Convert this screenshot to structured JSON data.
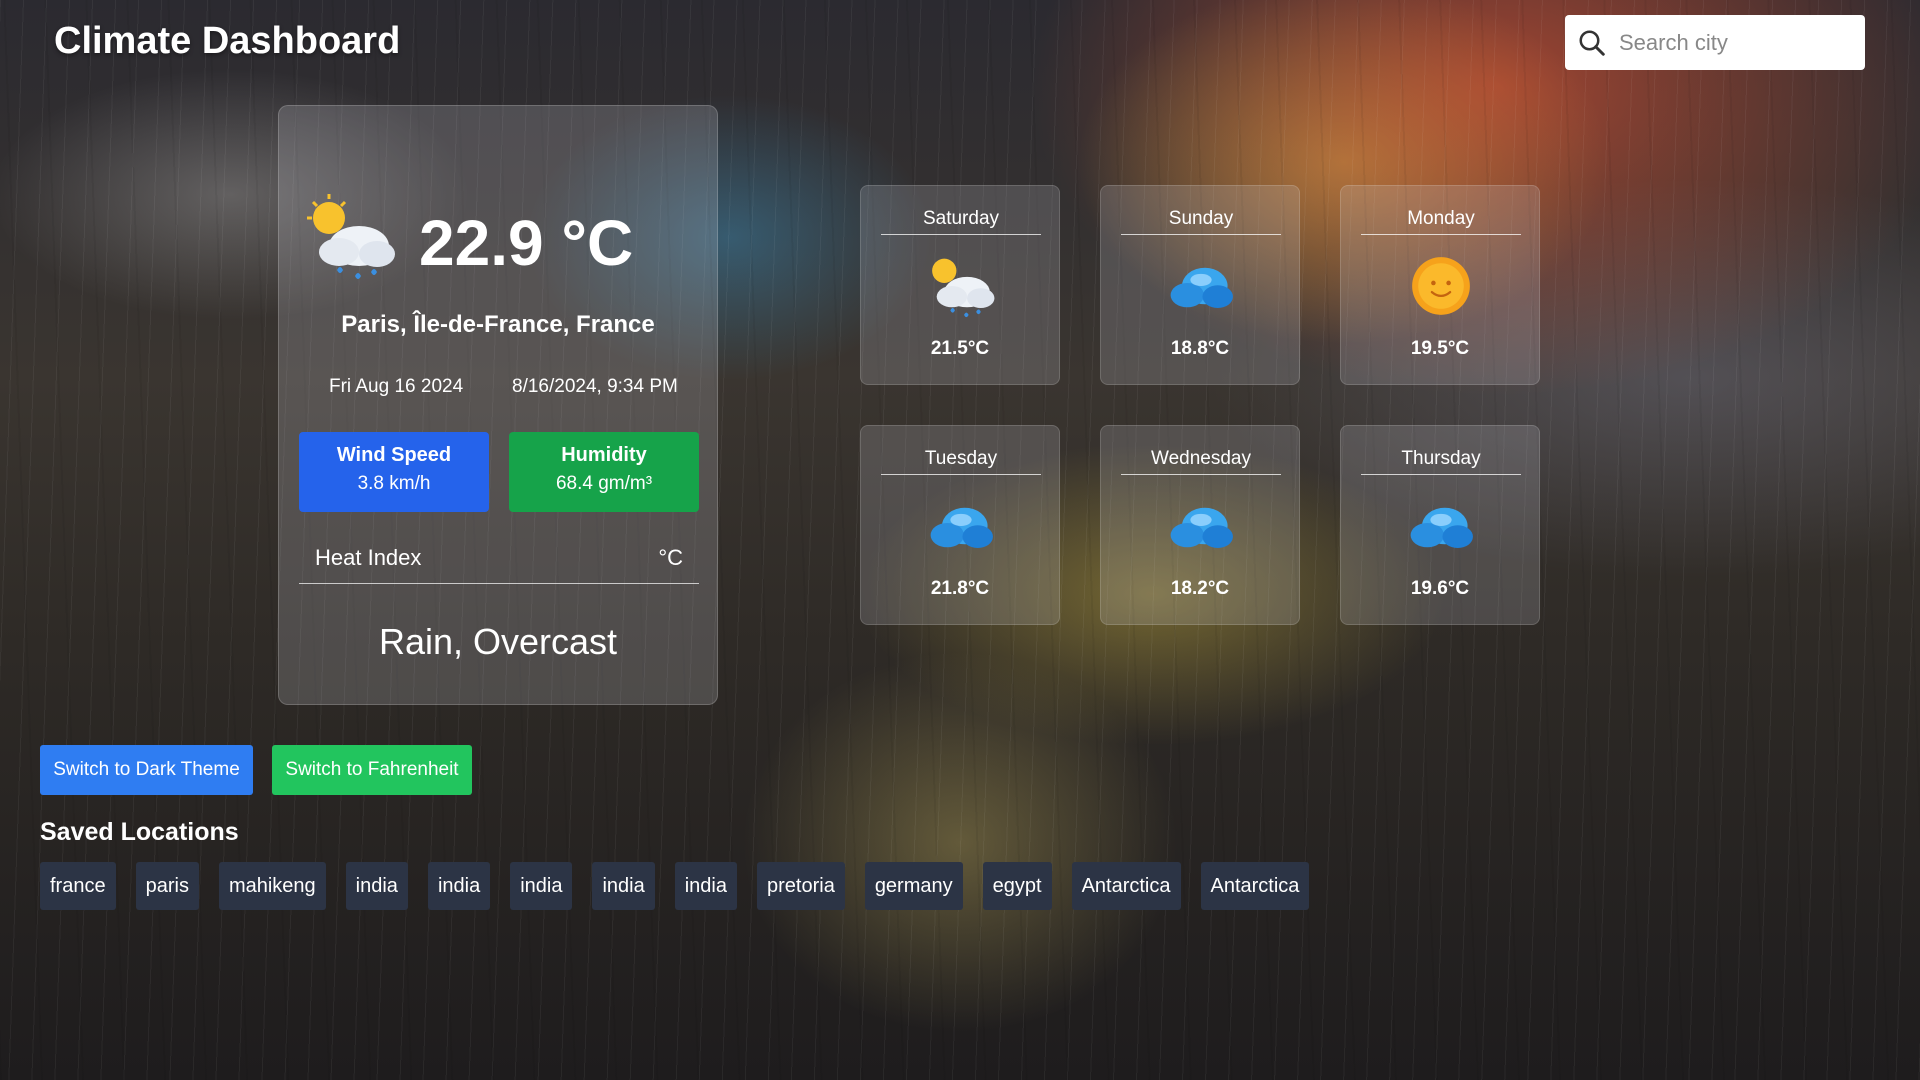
{
  "header": {
    "title": "Climate Dashboard",
    "search_placeholder": "Search city"
  },
  "current": {
    "temperature": "22.9 °C",
    "location": "Paris, Île-de-France, France",
    "date": "Fri Aug 16 2024",
    "datetime": "8/16/2024, 9:34 PM",
    "wind_label": "Wind Speed",
    "wind_value": "3.8 km/h",
    "humidity_label": "Humidity",
    "humidity_value": "68.4 gm/m³",
    "heat_index_label": "Heat Index",
    "heat_index_unit": "°C",
    "condition": "Rain, Overcast",
    "icon": "sun-rain-cloud-icon"
  },
  "forecast": [
    {
      "day": "Saturday",
      "temp": "21.5°C",
      "icon": "sun-rain-cloud-icon"
    },
    {
      "day": "Sunday",
      "temp": "18.8°C",
      "icon": "cloud-icon"
    },
    {
      "day": "Monday",
      "temp": "19.5°C",
      "icon": "sun-icon"
    },
    {
      "day": "Tuesday",
      "temp": "21.8°C",
      "icon": "cloud-icon"
    },
    {
      "day": "Wednesday",
      "temp": "18.2°C",
      "icon": "cloud-icon"
    },
    {
      "day": "Thursday",
      "temp": "19.6°C",
      "icon": "cloud-icon"
    }
  ],
  "controls": {
    "theme_button": "Switch to Dark Theme",
    "unit_button": "Switch to Fahrenheit"
  },
  "saved": {
    "title": "Saved Locations",
    "items": [
      "france",
      "paris",
      "mahikeng",
      "india",
      "india",
      "india",
      "india",
      "india",
      "pretoria",
      "germany",
      "egypt",
      "Antarctica",
      "Antarctica"
    ]
  },
  "colors": {
    "wind_box": "#2563eb",
    "humidity_box": "#16a34a",
    "theme_button": "#2f7df2",
    "unit_button": "#22c55e",
    "chip_bg": "#2c3445"
  }
}
